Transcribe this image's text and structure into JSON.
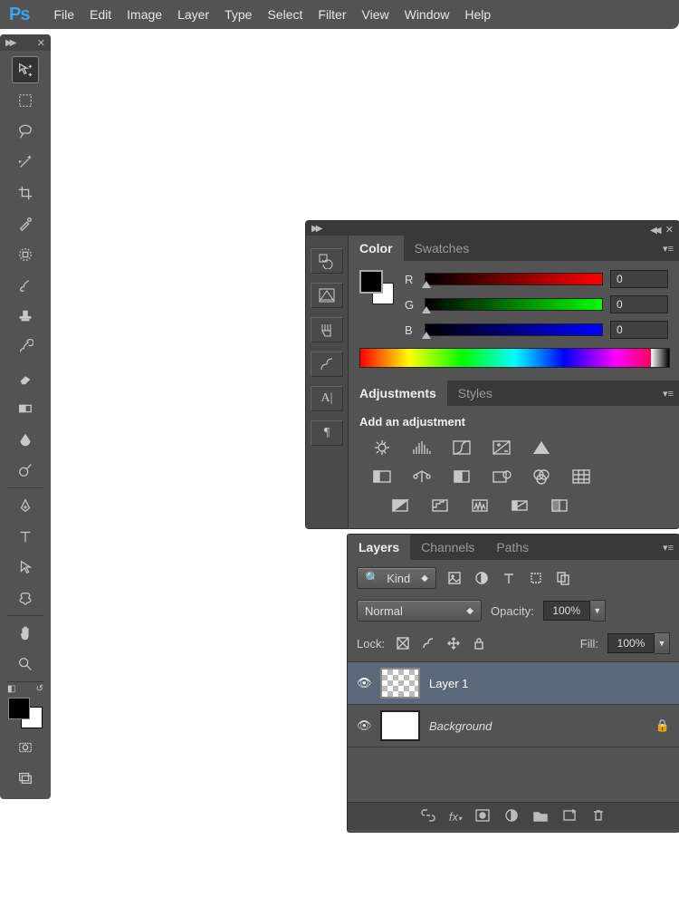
{
  "app": {
    "logo": "Ps"
  },
  "menu": [
    "File",
    "Edit",
    "Image",
    "Layer",
    "Type",
    "Select",
    "Filter",
    "View",
    "Window",
    "Help"
  ],
  "color_panel": {
    "tab_color": "Color",
    "tab_swatches": "Swatches",
    "r_label": "R",
    "g_label": "G",
    "b_label": "B",
    "r_val": "0",
    "g_val": "0",
    "b_val": "0"
  },
  "adjustments_panel": {
    "tab_adj": "Adjustments",
    "tab_styles": "Styles",
    "heading": "Add an adjustment"
  },
  "layers_panel": {
    "tab_layers": "Layers",
    "tab_channels": "Channels",
    "tab_paths": "Paths",
    "kind_filter": "Kind",
    "blend_mode": "Normal",
    "opacity_label": "Opacity:",
    "opacity_value": "100%",
    "lock_label": "Lock:",
    "fill_label": "Fill:",
    "fill_value": "100%",
    "layer1_name": "Layer 1",
    "background_name": "Background"
  }
}
